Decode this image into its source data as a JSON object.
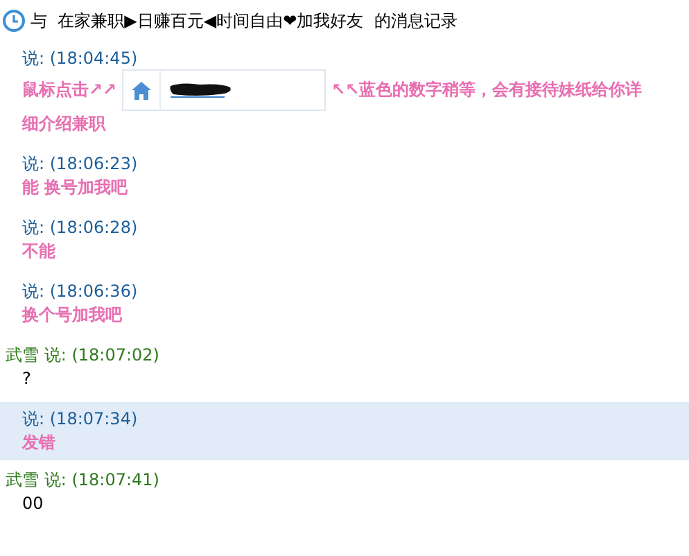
{
  "window": {
    "title": "与  在家兼职▶日赚百元◀时间自由❤加我好友  的消息记录"
  },
  "messages": [
    {
      "kind": "them",
      "selected": false,
      "said": "说:",
      "time": "(18:04:45)",
      "body_before": "鼠标点击↗↗",
      "card_after": "↖↖蓝色的数字稍等，会有接待妹纸给你详",
      "continuation": "细介绍兼职"
    },
    {
      "kind": "them",
      "selected": false,
      "said": "说:",
      "time": "(18:06:23)",
      "body_before": "能 换号加我吧"
    },
    {
      "kind": "them",
      "selected": false,
      "said": "说:",
      "time": "(18:06:28)",
      "body_before": "不能"
    },
    {
      "kind": "them",
      "selected": false,
      "said": "说:",
      "time": "(18:06:36)",
      "body_before": "换个号加我吧"
    },
    {
      "kind": "me",
      "selected": false,
      "sender": "武雪",
      "said": "说:",
      "time": "(18:07:02)",
      "body_before": "?"
    },
    {
      "kind": "them",
      "selected": true,
      "said": "说:",
      "time": "(18:07:34)",
      "body_before": "发错"
    },
    {
      "kind": "me",
      "selected": false,
      "sender": "武雪",
      "said": "说:",
      "time": "(18:07:41)",
      "body_before": "00"
    }
  ]
}
